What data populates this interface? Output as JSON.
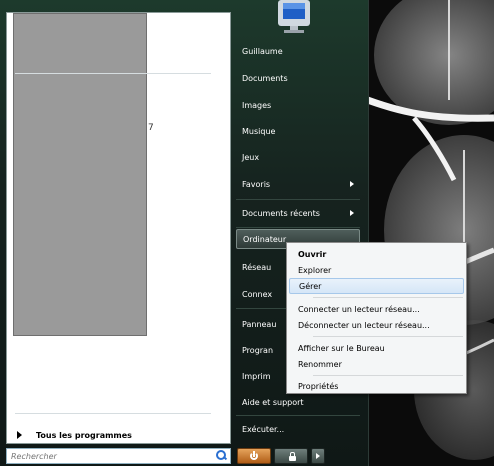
{
  "left_pane": {
    "stray_text": "7",
    "all_programs_label": "Tous les programmes"
  },
  "search": {
    "placeholder": "Rechercher"
  },
  "right_pane": {
    "items": [
      {
        "label": "Guillaume"
      },
      {
        "label": "Documents"
      },
      {
        "label": "Images"
      },
      {
        "label": "Musique"
      },
      {
        "label": "Jeux"
      },
      {
        "label": "Favoris"
      },
      {
        "label": "Documents récents"
      },
      {
        "label": "Ordinateur"
      },
      {
        "label": "Réseau"
      },
      {
        "label": "Connex"
      },
      {
        "label": "Panneau"
      },
      {
        "label": "Progran"
      },
      {
        "label": "Imprim"
      },
      {
        "label": "Aide et support"
      },
      {
        "label": "Exécuter..."
      }
    ]
  },
  "context_menu": {
    "items": [
      {
        "label": "Ouvrir"
      },
      {
        "label": "Explorer"
      },
      {
        "label": "Gérer"
      },
      {
        "label": "Connecter un lecteur réseau..."
      },
      {
        "label": "Déconnecter un lecteur réseau..."
      },
      {
        "label": "Afficher sur le Bureau"
      },
      {
        "label": "Renommer"
      },
      {
        "label": "Propriétés"
      }
    ]
  },
  "colors": {
    "accent": "#2a6fd1",
    "power": "#d9893b",
    "menu_bg": "#16231f"
  }
}
